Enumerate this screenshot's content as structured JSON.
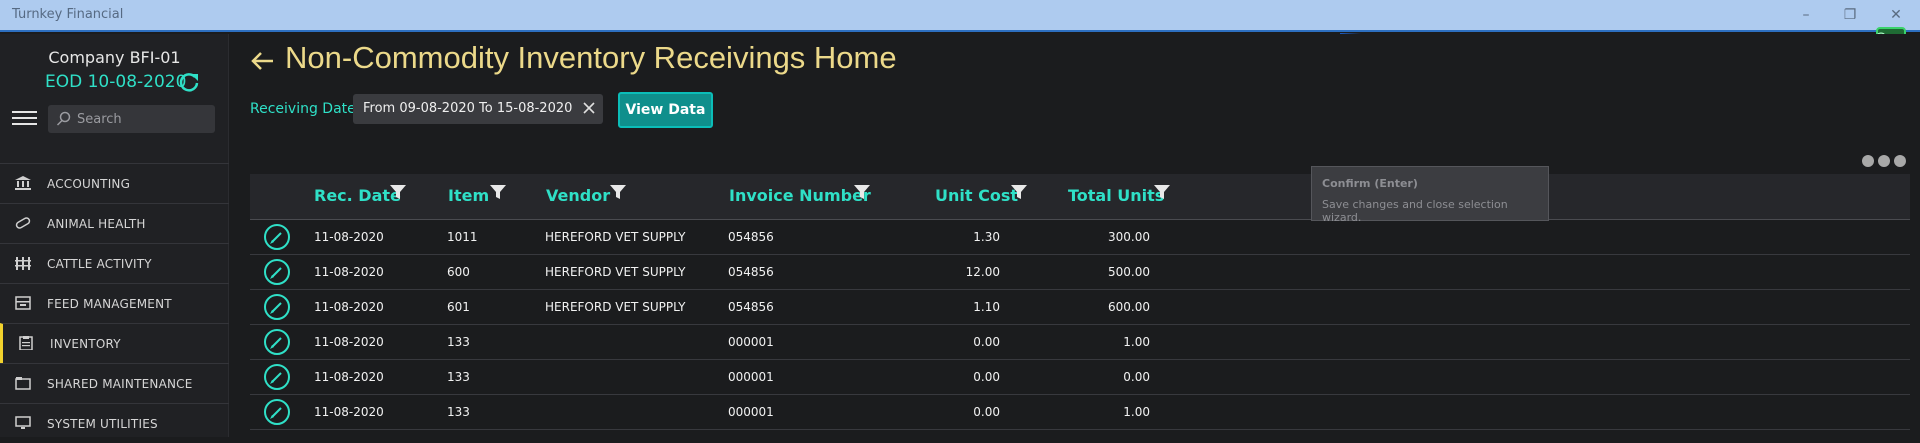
{
  "window": {
    "title": "Turnkey Financial",
    "controls": [
      "minimize-icon",
      "restore-icon",
      "close-icon"
    ]
  },
  "sidebar": {
    "company": "Company BFI-01",
    "eod": "EOD 10-08-2020",
    "search_placeholder": "Search",
    "items": [
      {
        "label": "ACCOUNTING",
        "icon": "bank-icon"
      },
      {
        "label": "ANIMAL HEALTH",
        "icon": "pill-icon"
      },
      {
        "label": "CATTLE ACTIVITY",
        "icon": "fence-icon"
      },
      {
        "label": "FEED MANAGEMENT",
        "icon": "feed-icon"
      },
      {
        "label": "INVENTORY",
        "icon": "clipboard-icon",
        "active": true
      },
      {
        "label": "SHARED MAINTENANCE",
        "icon": "folder-icon"
      },
      {
        "label": "SYSTEM UTILITIES",
        "icon": "monitor-icon"
      }
    ]
  },
  "main": {
    "title": "Non-Commodity Inventory Receivings Home",
    "filter": {
      "label": "Receiving Date",
      "value": "From 09-08-2020 To 15-08-2020",
      "button": "View Data"
    },
    "columns": [
      "Rec. Date",
      "Item",
      "Vendor",
      "Invoice Number",
      "Unit Cost",
      "Total Units"
    ],
    "rows": [
      [
        "11-08-2020",
        "1011",
        "HEREFORD VET SUPPLY",
        "054856",
        "1.30",
        "300.00"
      ],
      [
        "11-08-2020",
        "600",
        "HEREFORD VET SUPPLY",
        "054856",
        "12.00",
        "500.00"
      ],
      [
        "11-08-2020",
        "601",
        "HEREFORD VET SUPPLY",
        "054856",
        "1.10",
        "600.00"
      ],
      [
        "11-08-2020",
        "133",
        "",
        "000001",
        "0.00",
        "1.00"
      ],
      [
        "11-08-2020",
        "133",
        "",
        "000001",
        "0.00",
        "0.00"
      ],
      [
        "11-08-2020",
        "133",
        "",
        "000001",
        "0.00",
        "1.00"
      ]
    ]
  },
  "tooltip": {
    "title": "Confirm (Enter)",
    "text": "Save changes and close selection wizard."
  },
  "colors": {
    "accent": "#2fe0c7",
    "title": "#ecd98a",
    "active_marker": "#f2d22d",
    "button": "#0f8f8c"
  }
}
